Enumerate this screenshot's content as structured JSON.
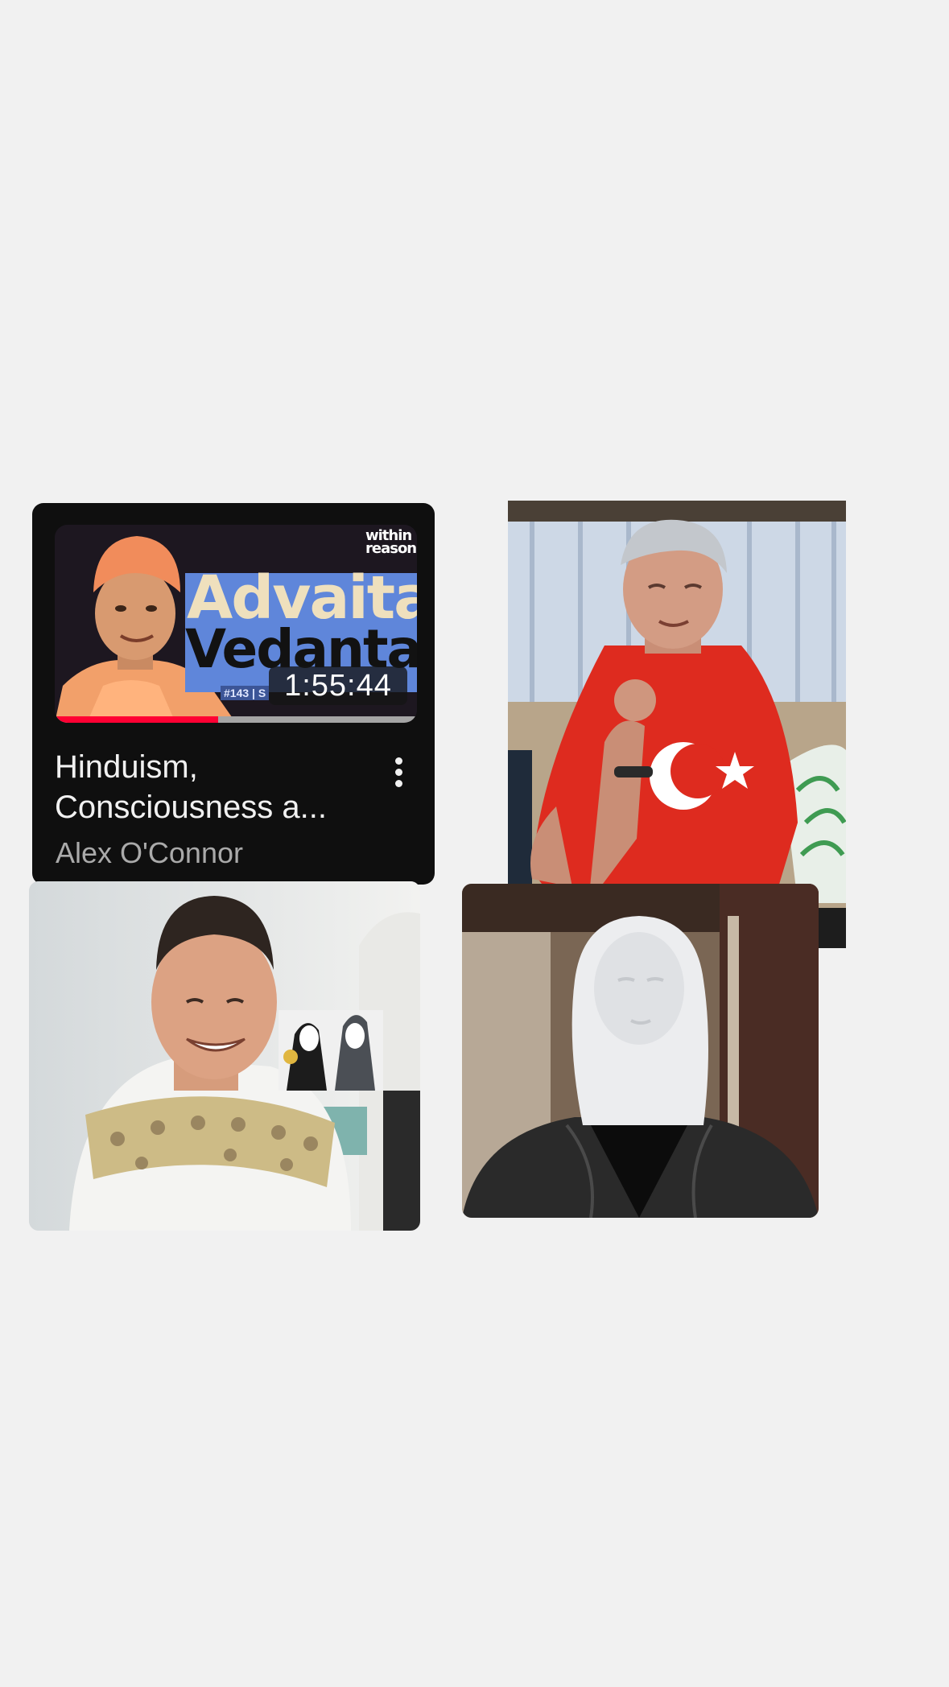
{
  "page": {
    "background": "#f1f1f1"
  },
  "video_card": {
    "thumbnail": {
      "logo_line1": "within",
      "logo_line2": "reason",
      "headline_line1": "Advaita",
      "headline_line2": "Vedanta",
      "episode_tag": "#143 | S",
      "duration": "1:55:44",
      "watched_fraction": 0.45
    },
    "title": "Hinduism, Consciousness a...",
    "channel": "Alex O'Connor",
    "more_icon": "more-vertical-icon",
    "colors": {
      "card_bg": "#0f0f0f",
      "progress": "#ff0033"
    }
  },
  "photos": [
    {
      "icon": "photo-man-red-shirt-with-flag"
    },
    {
      "icon": "photo-smiling-man-banknote-necklace"
    },
    {
      "icon": "photo-masked-figure-white-balaclava"
    }
  ]
}
